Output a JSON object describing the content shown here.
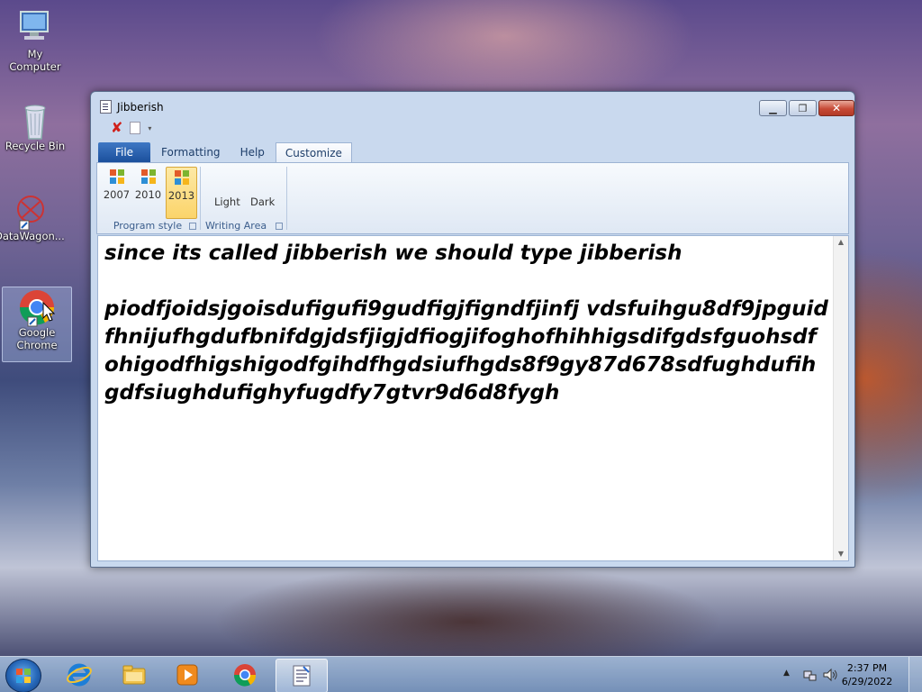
{
  "desktop": {
    "icons": [
      {
        "label": "My Computer"
      },
      {
        "label": "Recycle Bin"
      },
      {
        "label": "DataWagon..."
      },
      {
        "label": "Google Chrome"
      }
    ]
  },
  "window": {
    "title": "Jibberish",
    "controls": {
      "minimize": "▁",
      "maximize": "❐",
      "close": "✕"
    },
    "quick_access": {
      "close_glyph": "✘",
      "more_glyph": "▾"
    },
    "tabs": [
      {
        "label": "File"
      },
      {
        "label": "Formatting"
      },
      {
        "label": "Help"
      },
      {
        "label": "Customize"
      }
    ],
    "active_tab": "Customize",
    "ribbon": {
      "program_style": {
        "label": "Program style",
        "buttons": [
          {
            "label": "2007"
          },
          {
            "label": "2010"
          },
          {
            "label": "2013"
          }
        ],
        "selected": "2013"
      },
      "writing_area": {
        "label": "Writing Area",
        "buttons": [
          {
            "label": "Light"
          },
          {
            "label": "Dark"
          }
        ]
      }
    },
    "document": {
      "text": "since its called jibberish we should type jibberish\n\npiodfjoidsjgoisdufigufi9gudfigjfigndfjinfj vdsfuihgu8df9jpguidfhnijufhgdufbnifdgjdsfjigjdfiogjifoghofhihhigsdifgdsfguohsdfohigodfhigshigodfgihdfhgdsiufhgds8f9gy87d678sdfughdufihgdfsiughdufighyfugdfy7gtvr9d6d8fygh"
    }
  },
  "taskbar": {
    "items": [
      {
        "name": "internet-explorer"
      },
      {
        "name": "file-explorer"
      },
      {
        "name": "media-player"
      },
      {
        "name": "google-chrome"
      },
      {
        "name": "jibberish"
      }
    ],
    "clock": {
      "time": "2:37 PM",
      "date": "6/29/2022"
    }
  }
}
